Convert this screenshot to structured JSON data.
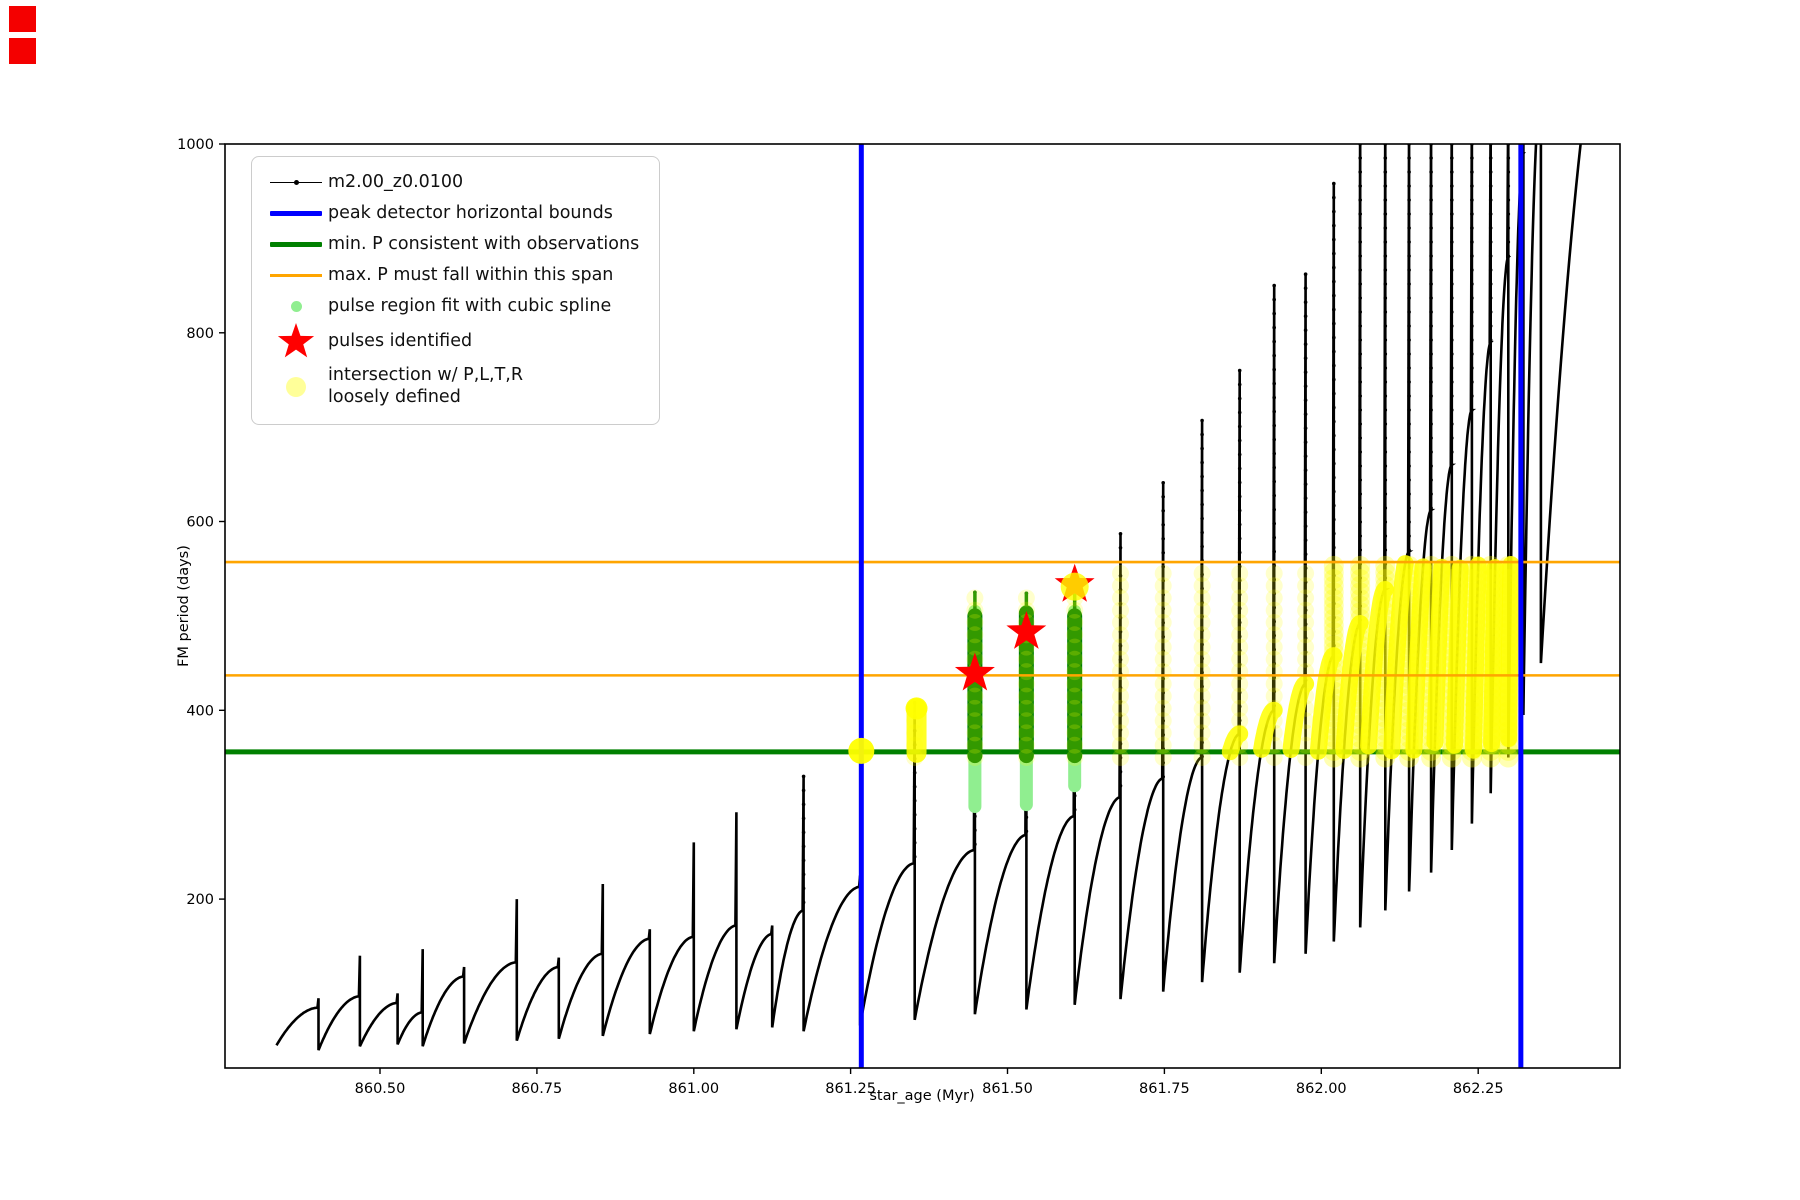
{
  "decorations": {
    "top_left_squares": {
      "color": "#f40000",
      "count": 2
    }
  },
  "legend": {
    "items": [
      {
        "label": "m2.00_z0.0100",
        "marker": "line-with-dot",
        "color": "#000000"
      },
      {
        "label": "peak detector horizontal bounds",
        "marker": "thick-line",
        "color": "#0000ff"
      },
      {
        "label": "min. P consistent with observations",
        "marker": "thick-line",
        "color": "#008000"
      },
      {
        "label": "max. P must fall within this span",
        "marker": "line",
        "color": "#ffa500"
      },
      {
        "label": "pulse region fit with cubic spline",
        "marker": "dot-small",
        "color": "#90ee90"
      },
      {
        "label": "pulses identified",
        "marker": "star",
        "color": "#ff0000"
      },
      {
        "label": "intersection w/ P,L,T,R",
        "label2": "loosely defined",
        "marker": "dot-large-translucent",
        "color": "#ffff00"
      }
    ]
  },
  "chart_data": {
    "type": "line",
    "title": "",
    "xlabel": "star_age (Myr)",
    "ylabel": "FM period (days)",
    "xlim": [
      860.253,
      862.476
    ],
    "ylim": [
      21,
      1000
    ],
    "xticks": [
      860.5,
      860.75,
      861.0,
      861.25,
      861.5,
      861.75,
      862.0,
      862.25
    ],
    "xtick_labels": [
      "860.50",
      "860.75",
      "861.00",
      "861.25",
      "861.50",
      "861.75",
      "862.00",
      "862.25"
    ],
    "yticks": [
      200,
      400,
      600,
      800,
      1000
    ],
    "ytick_labels": [
      "200",
      "400",
      "600",
      "800",
      "1000"
    ],
    "grid": false,
    "legend_position": "upper left",
    "series": {
      "name": "m2.00_z0.0100",
      "color": "#000000"
    },
    "curve_start_age": 860.335,
    "pulse_cycles": [
      [
        860.402,
        45,
        85,
        95
      ],
      [
        860.468,
        40,
        97,
        140
      ],
      [
        860.528,
        44,
        90,
        100
      ],
      [
        860.568,
        46,
        80,
        147
      ],
      [
        860.634,
        44,
        118,
        128
      ],
      [
        860.718,
        47,
        133,
        200
      ],
      [
        860.785,
        50,
        128,
        138
      ],
      [
        860.855,
        52,
        142,
        216
      ],
      [
        860.93,
        55,
        158,
        168
      ],
      [
        861.0,
        57,
        160,
        260
      ],
      [
        861.068,
        60,
        172,
        292
      ],
      [
        861.125,
        62,
        163,
        172
      ],
      [
        861.175,
        64,
        188,
        330
      ],
      [
        861.265,
        60,
        213,
        225
      ],
      [
        861.352,
        66,
        238,
        408
      ],
      [
        861.448,
        72,
        252,
        525
      ],
      [
        861.53,
        78,
        268,
        524
      ],
      [
        861.607,
        83,
        288,
        532
      ],
      [
        861.68,
        88,
        308,
        587
      ],
      [
        861.748,
        94,
        328,
        641
      ],
      [
        861.81,
        102,
        350,
        707
      ],
      [
        861.87,
        112,
        375,
        760
      ],
      [
        861.925,
        122,
        400,
        850
      ],
      [
        861.975,
        132,
        428,
        862
      ],
      [
        862.02,
        142,
        458,
        958
      ],
      [
        862.062,
        155,
        492,
        1060
      ],
      [
        862.102,
        170,
        528,
        1060
      ],
      [
        862.14,
        188,
        568,
        1060
      ],
      [
        862.175,
        208,
        612,
        1060
      ],
      [
        862.208,
        228,
        660,
        1060
      ],
      [
        862.24,
        252,
        718,
        1060
      ],
      [
        862.27,
        280,
        790,
        1060
      ],
      [
        862.298,
        312,
        880,
        1060
      ],
      [
        862.322,
        350,
        990,
        1060
      ],
      [
        862.35,
        395,
        1060,
        1060
      ],
      [
        862.476,
        450,
        1200,
        1200
      ]
    ],
    "peak_detector_bounds": {
      "color": "#0000ff",
      "ages": [
        861.267,
        862.318
      ]
    },
    "min_P_line": {
      "color": "#008000",
      "value": 356
    },
    "max_P_span": {
      "color": "#ffa500",
      "values": [
        437,
        557
      ]
    },
    "pulses_identified": {
      "color": "#ff0000",
      "points": [
        [
          861.448,
          439
        ],
        [
          861.53,
          483
        ],
        [
          861.607,
          533
        ]
      ]
    },
    "spline_regions": {
      "dot_color": "#90ee90",
      "bar_color": "#008000",
      "columns": [
        {
          "age": 861.448,
          "spline_lo": 298,
          "spline_hi": 505,
          "bar_lo": 352,
          "bar_hi": 500,
          "tip": 525
        },
        {
          "age": 861.53,
          "spline_lo": 300,
          "spline_hi": 505,
          "bar_lo": 352,
          "bar_hi": 503,
          "tip": 524
        },
        {
          "age": 861.607,
          "spline_lo": 320,
          "spline_hi": 505,
          "bar_lo": 352,
          "bar_hi": 500,
          "tip": 532
        }
      ]
    },
    "loose_intersections": {
      "color": "#ffff00",
      "p_range": [
        350,
        557
      ],
      "age_range": [
        861.267,
        862.318
      ],
      "blobs": [
        {
          "age": 861.267,
          "p": 357,
          "r": 13
        },
        {
          "age": 861.355,
          "p_lo": 355,
          "p_hi": 402,
          "r": 11
        },
        {
          "age": 861.607,
          "p": 531,
          "r": 14
        }
      ]
    }
  }
}
